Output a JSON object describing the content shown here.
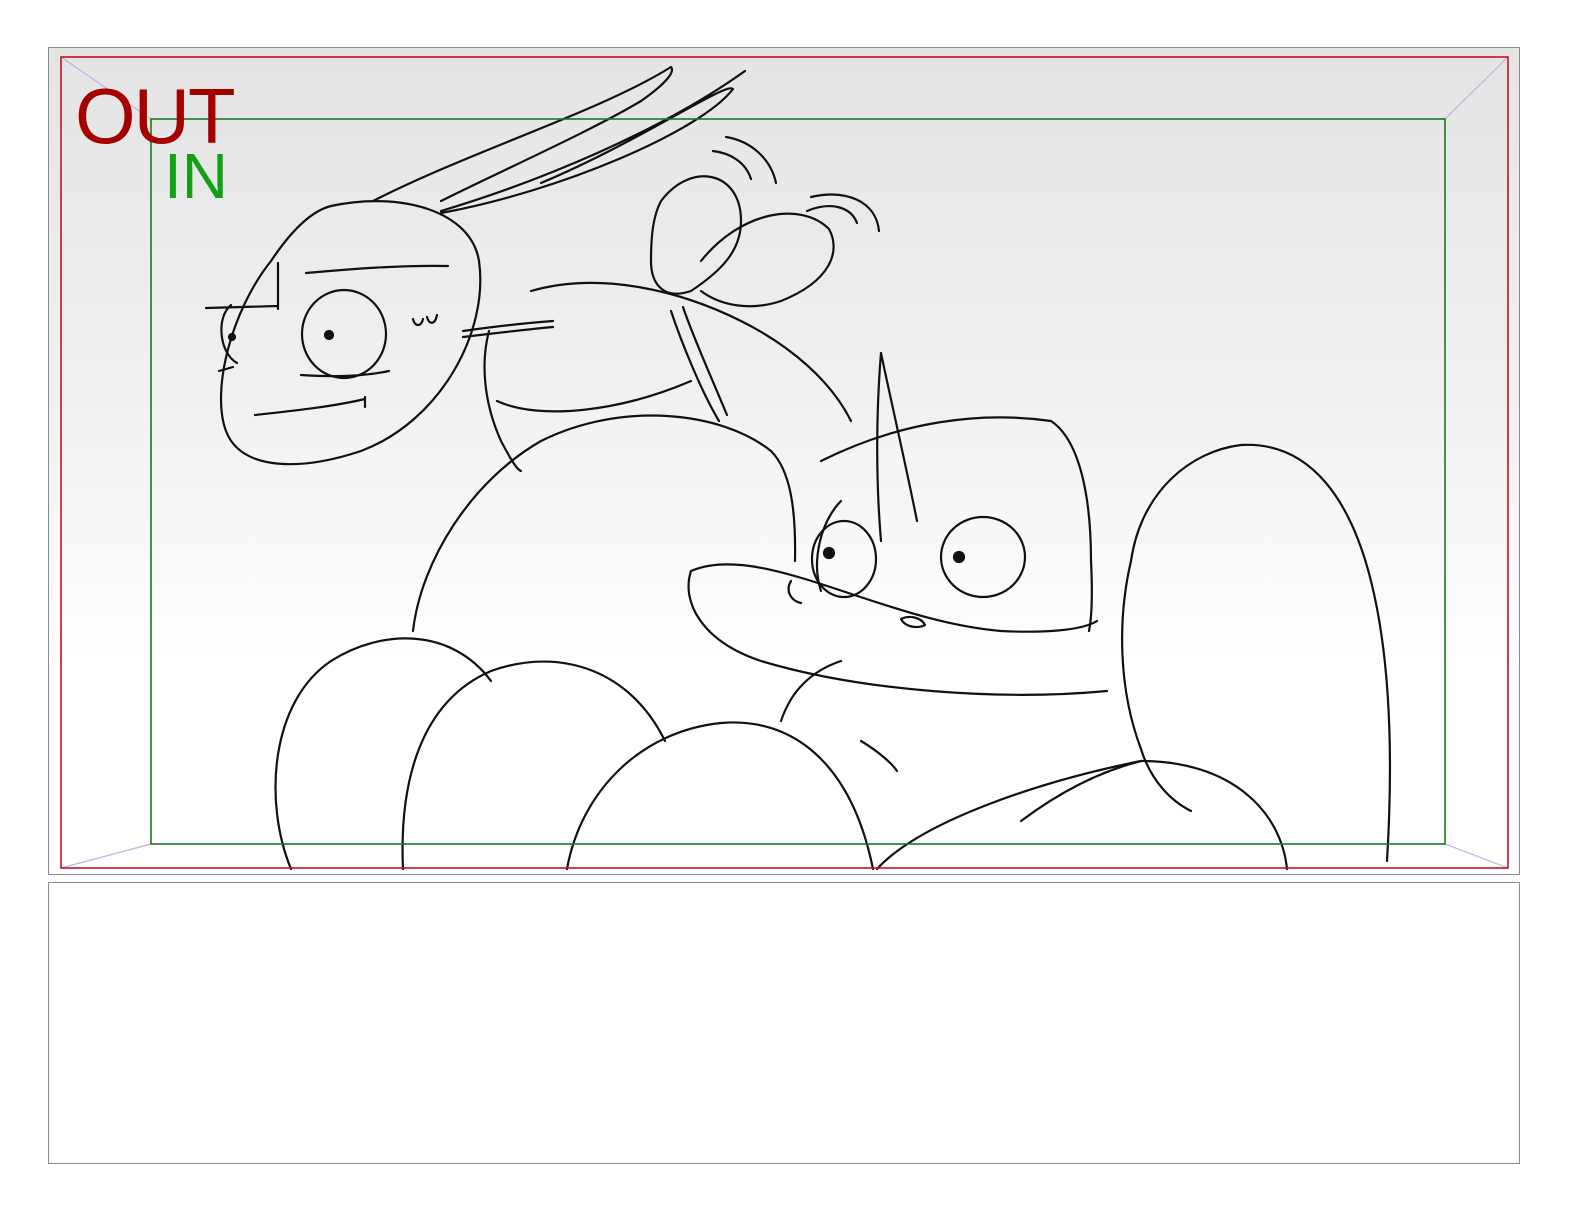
{
  "storyboard": {
    "safe_area_labels": {
      "outer_label": "OUT",
      "inner_label": "IN"
    },
    "colors": {
      "outer_frame": "#c0141e",
      "inner_frame": "#1a7a1a",
      "outer_label": "#a50000",
      "inner_label": "#14a014",
      "corner_guides": "#b4b4e6",
      "panel_border": "#8a8a8a",
      "sketch_lines": "#111111"
    },
    "notes": {
      "text": ""
    }
  }
}
